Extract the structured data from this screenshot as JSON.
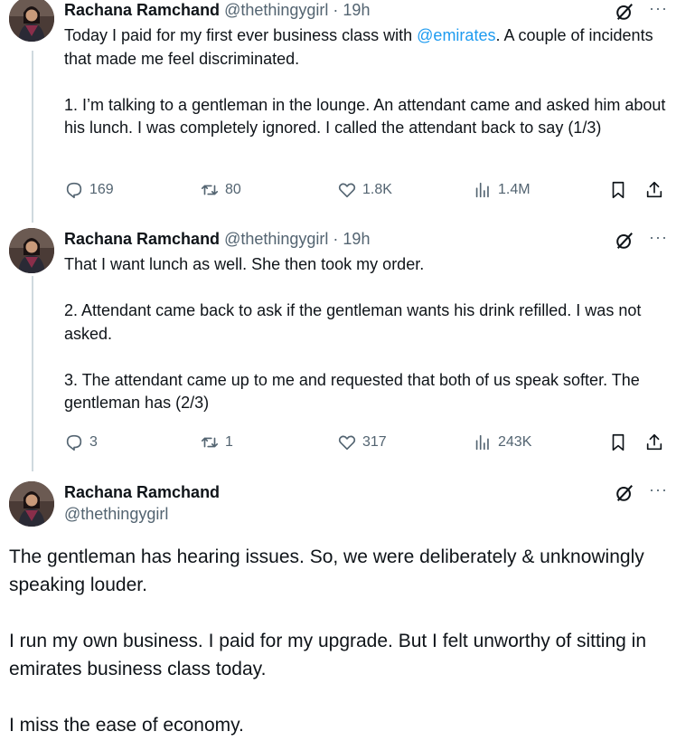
{
  "colors": {
    "text": "#0f1419",
    "secondary": "#536471",
    "link": "#1d9bf0",
    "thread_line": "#cfd9de"
  },
  "tweets": [
    {
      "name": "Rachana Ramchand",
      "handle": "@thethingygirl",
      "time": " · 19h",
      "lines": [
        {
          "pre": "Today I paid for my first ever business class with ",
          "mention": "@emirates",
          "post": ". A couple of incidents that made me feel discriminated."
        },
        {
          "text": "1. I’m talking to a gentleman in the lounge. An attendant came and asked him about his lunch. I was completely ignored. I called the attendant back to say (1/3)"
        }
      ],
      "replies": "169",
      "reposts": "80",
      "likes": "1.8K",
      "views": "1.4M"
    },
    {
      "name": "Rachana Ramchand",
      "handle": "@thethingygirl",
      "time": " · 19h",
      "paragraphs": [
        "That I want lunch as well. She then took my order.",
        "2. Attendant came back to ask if the gentleman wants his drink refilled. I was not asked.",
        "3. The attendant came up to me and requested that both of us speak softer. The gentleman has (2/3)"
      ],
      "replies": "3",
      "reposts": "1",
      "likes": "317",
      "views": "243K"
    }
  ],
  "main_tweet": {
    "name": "Rachana Ramchand",
    "handle": "@thethingygirl",
    "paragraphs": [
      "The gentleman has hearing issues. So, we were deliberately & unknowingly speaking louder.",
      "I run my own business. I paid for my upgrade. But I felt unworthy of sitting in emirates business class today.",
      "I miss the ease of economy."
    ]
  },
  "icons": {
    "grok": "grok-icon",
    "more": "more-icon",
    "reply": "reply-icon",
    "repost": "repost-icon",
    "like": "heart-icon",
    "views": "views-icon",
    "bookmark": "bookmark-icon",
    "share": "share-icon",
    "more_glyph": "···"
  }
}
